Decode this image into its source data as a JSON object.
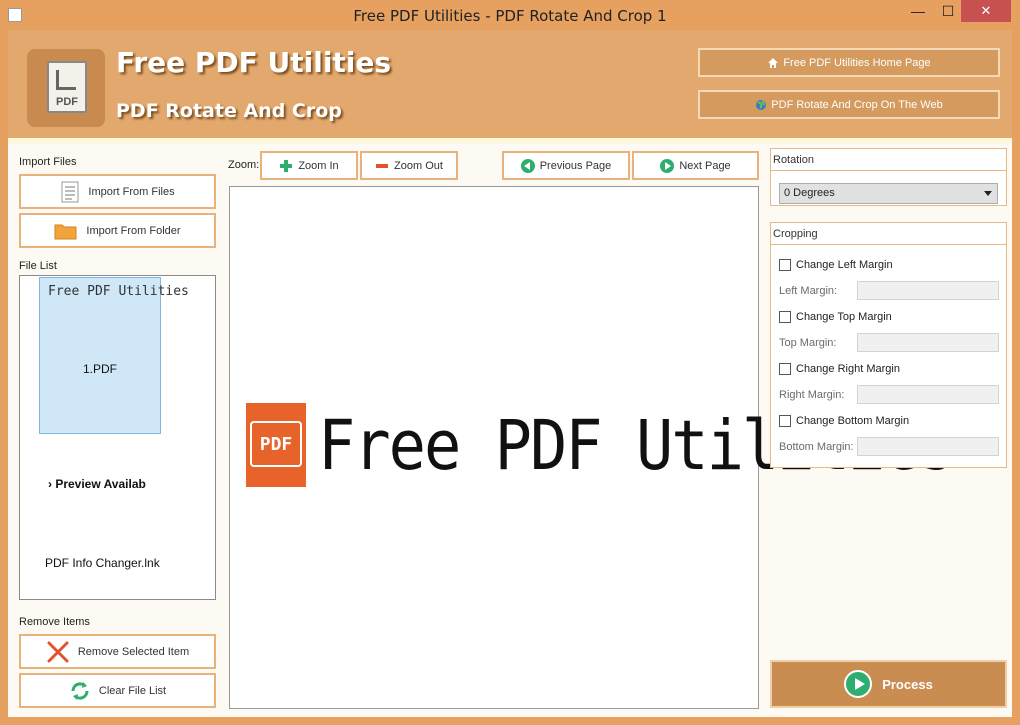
{
  "window": {
    "title": "Free PDF Utilities - PDF Rotate And Crop 1",
    "min_glyph": "—",
    "max_glyph": "☐",
    "close_glyph": "✕"
  },
  "header": {
    "app_name": "Free PDF Utilities",
    "subtitle": "PDF Rotate And Crop",
    "logo_text": "PDF",
    "home_button": "Free PDF Utilities Home Page",
    "web_button": "PDF Rotate And Crop On The Web"
  },
  "left": {
    "import_label": "Import Files",
    "import_files": "Import From Files",
    "import_folder": "Import From Folder",
    "file_list_label": "File List",
    "files": [
      {
        "thumb_text": "Free PDF Utilities",
        "name": "1.PDF",
        "selected": true
      },
      {
        "preview_text": "› Preview Availab",
        "name": "PDF Info Changer.lnk",
        "selected": false
      }
    ],
    "remove_label": "Remove Items",
    "remove_selected": "Remove Selected Item",
    "clear_list": "Clear File List"
  },
  "center": {
    "zoom_label": "Zoom:",
    "zoom_in": "Zoom In",
    "zoom_out": "Zoom Out",
    "previous_page": "Previous Page",
    "next_page": "Next Page",
    "page_brand": "Free PDF Utilities",
    "page_icon_text": "PDF"
  },
  "right": {
    "rotation_title": "Rotation",
    "rotation_value": "0 Degrees",
    "cropping_title": "Cropping",
    "change_left": "Change Left Margin",
    "left_margin": "Left Margin:",
    "change_top": "Change Top Margin",
    "top_margin": "Top Margin:",
    "change_right": "Change Right Margin",
    "right_margin": "Right Margin:",
    "change_bottom": "Change Bottom Margin",
    "bottom_margin": "Bottom Margin:",
    "process": "Process"
  },
  "colors": {
    "accent": "#e6a160",
    "header_bg": "#e2a86d",
    "button_border": "#e8b27c",
    "process_bg": "#c98d52",
    "green": "#2eae6e",
    "red": "#e8632a"
  }
}
